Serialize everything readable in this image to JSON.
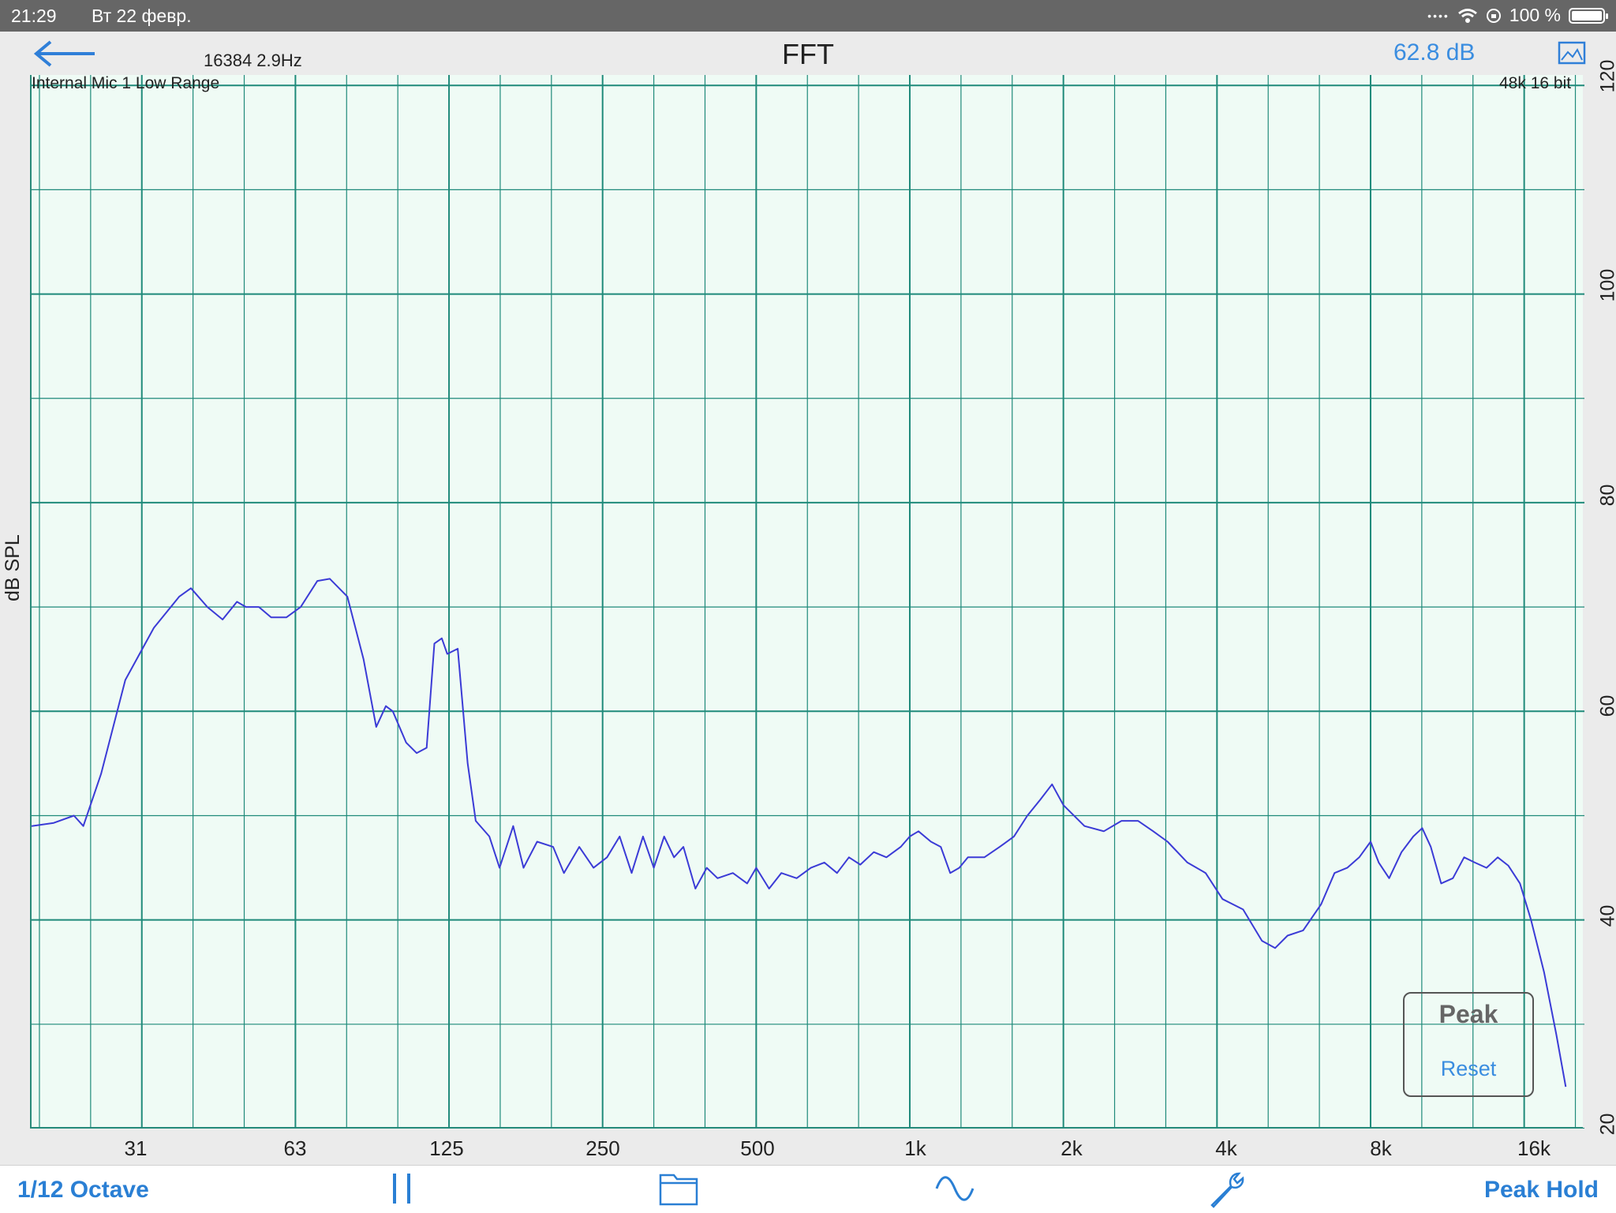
{
  "status_bar": {
    "time": "21:29",
    "date": "Вт 22 февр.",
    "battery": "100 %",
    "icons": [
      "signal-dots-icon",
      "wifi-icon",
      "orientation-lock-icon",
      "battery-icon"
    ]
  },
  "header": {
    "fft_info": "16384  2.9Hz",
    "title": "FFT",
    "level": "62.8 dB",
    "back_icon": "back-arrow-icon",
    "image_icon": "image-icon"
  },
  "plot": {
    "mic": "Internal Mic 1 Low Range",
    "rate": "48k 16 bit",
    "ylabel": "dB SPL"
  },
  "chart_data": {
    "type": "line",
    "x_scale": "log",
    "ylim": [
      20,
      121
    ],
    "xlim": [
      19,
      21000
    ],
    "x_ticks": [
      "31",
      "63",
      "125",
      "250",
      "500",
      "1k",
      "2k",
      "4k",
      "8k",
      "16k"
    ],
    "y_ticks": [
      "120",
      "100",
      "80",
      "60",
      "40",
      "20"
    ],
    "grid": true,
    "series": [
      {
        "color": "#3b3bd6",
        "points": [
          [
            19,
            49
          ],
          [
            21,
            49.3
          ],
          [
            23,
            50
          ],
          [
            24,
            49
          ],
          [
            26,
            54
          ],
          [
            29,
            63
          ],
          [
            33,
            68
          ],
          [
            37,
            71
          ],
          [
            39,
            71.8
          ],
          [
            42,
            70
          ],
          [
            45,
            68.8
          ],
          [
            48,
            70.5
          ],
          [
            50,
            70
          ],
          [
            53,
            70
          ],
          [
            56,
            69
          ],
          [
            60,
            69
          ],
          [
            64,
            70
          ],
          [
            69,
            72.5
          ],
          [
            73,
            72.7
          ],
          [
            79,
            71
          ],
          [
            85,
            65
          ],
          [
            90,
            58.5
          ],
          [
            94,
            60.5
          ],
          [
            97,
            60
          ],
          [
            103,
            57
          ],
          [
            108,
            56
          ],
          [
            113,
            56.5
          ],
          [
            117,
            66.5
          ],
          [
            121,
            67
          ],
          [
            124,
            65.5
          ],
          [
            130,
            66
          ],
          [
            136,
            55
          ],
          [
            141,
            49.5
          ],
          [
            150,
            48
          ],
          [
            157,
            45
          ],
          [
            167,
            49
          ],
          [
            175,
            45
          ],
          [
            186,
            47.5
          ],
          [
            200,
            47
          ],
          [
            210,
            44.5
          ],
          [
            225,
            47
          ],
          [
            240,
            45
          ],
          [
            255,
            46
          ],
          [
            270,
            48
          ],
          [
            285,
            44.5
          ],
          [
            300,
            48
          ],
          [
            315,
            45
          ],
          [
            330,
            48
          ],
          [
            345,
            46
          ],
          [
            360,
            47
          ],
          [
            380,
            43
          ],
          [
            400,
            45
          ],
          [
            420,
            44
          ],
          [
            450,
            44.5
          ],
          [
            480,
            43.5
          ],
          [
            500,
            45
          ],
          [
            530,
            43
          ],
          [
            560,
            44.5
          ],
          [
            600,
            44
          ],
          [
            640,
            45
          ],
          [
            680,
            45.5
          ],
          [
            720,
            44.5
          ],
          [
            760,
            46
          ],
          [
            800,
            45.3
          ],
          [
            850,
            46.5
          ],
          [
            900,
            46
          ],
          [
            960,
            47
          ],
          [
            1000,
            48
          ],
          [
            1040,
            48.5
          ],
          [
            1100,
            47.5
          ],
          [
            1150,
            47
          ],
          [
            1200,
            44.5
          ],
          [
            1250,
            45
          ],
          [
            1300,
            46
          ],
          [
            1400,
            46
          ],
          [
            1500,
            47
          ],
          [
            1600,
            48
          ],
          [
            1700,
            50
          ],
          [
            1800,
            51.5
          ],
          [
            1900,
            53
          ],
          [
            2000,
            51
          ],
          [
            2200,
            49
          ],
          [
            2400,
            48.5
          ],
          [
            2600,
            49.5
          ],
          [
            2800,
            49.5
          ],
          [
            3000,
            48.5
          ],
          [
            3200,
            47.5
          ],
          [
            3500,
            45.5
          ],
          [
            3800,
            44.5
          ],
          [
            4100,
            42
          ],
          [
            4500,
            41
          ],
          [
            4900,
            38
          ],
          [
            5200,
            37.3
          ],
          [
            5500,
            38.5
          ],
          [
            5900,
            39
          ],
          [
            6400,
            41.5
          ],
          [
            6800,
            44.5
          ],
          [
            7200,
            45
          ],
          [
            7600,
            46
          ],
          [
            8000,
            47.5
          ],
          [
            8300,
            45.5
          ],
          [
            8700,
            44
          ],
          [
            9200,
            46.5
          ],
          [
            9700,
            48
          ],
          [
            10100,
            48.8
          ],
          [
            10500,
            47
          ],
          [
            11000,
            43.5
          ],
          [
            11600,
            44
          ],
          [
            12200,
            46
          ],
          [
            12800,
            45.5
          ],
          [
            13500,
            45
          ],
          [
            14200,
            46
          ],
          [
            14900,
            45.2
          ],
          [
            15700,
            43.5
          ],
          [
            16500,
            40
          ],
          [
            17500,
            35
          ],
          [
            18500,
            29
          ],
          [
            19300,
            24
          ]
        ]
      }
    ]
  },
  "peak_panel": {
    "title": "Peak",
    "reset": "Reset"
  },
  "toolbar": {
    "octave": "1/12 Octave",
    "peak_hold": "Peak Hold",
    "icons": [
      "pause-icon",
      "folder-icon",
      "sine-wave-icon",
      "wrench-icon"
    ]
  }
}
